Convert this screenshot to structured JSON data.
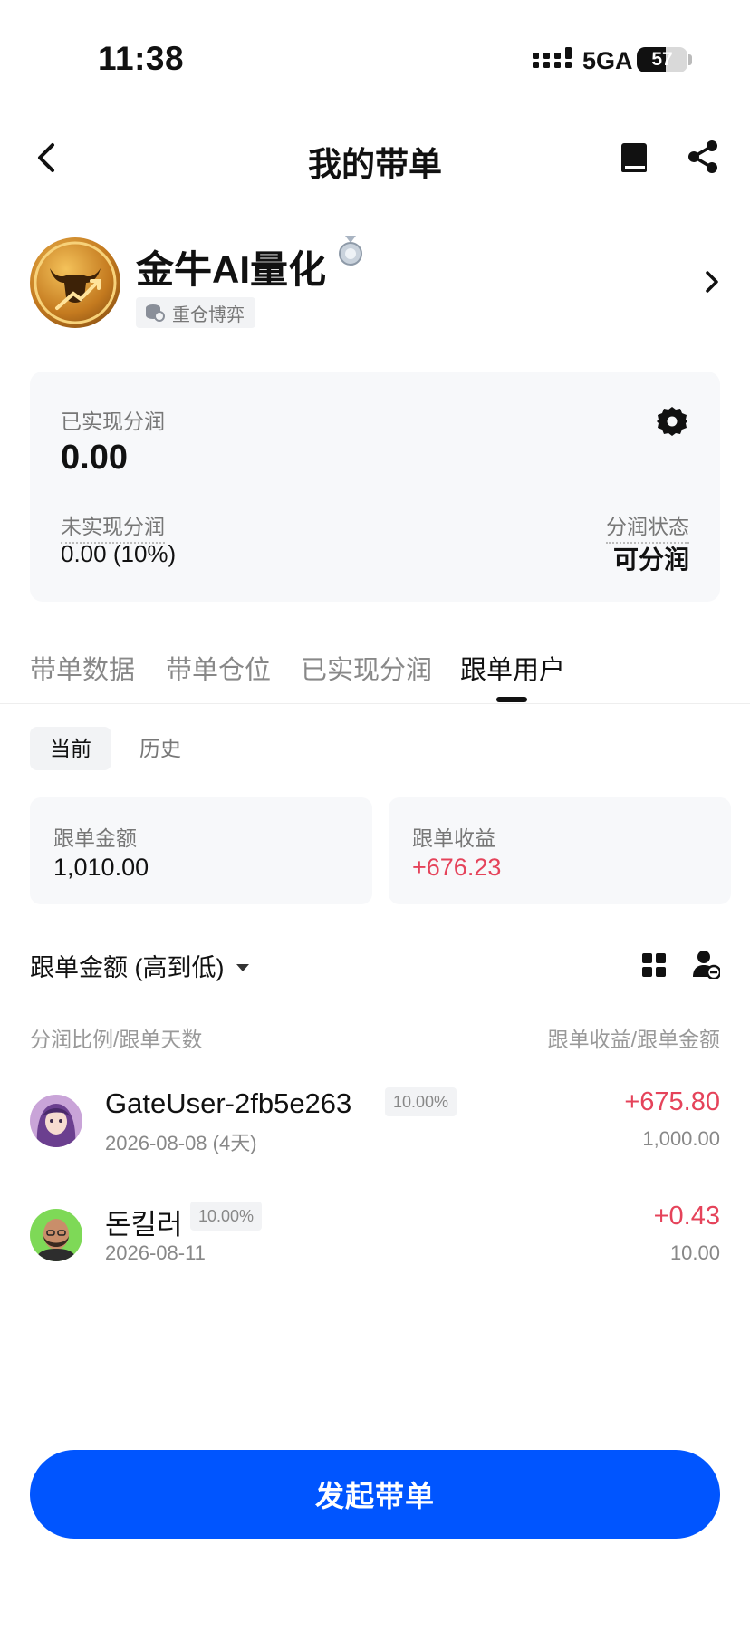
{
  "status_bar": {
    "time": "11:38",
    "network": "5GA",
    "battery": "57",
    "battery_level_percent": 57
  },
  "header": {
    "title": "我的带单",
    "icons": [
      "chevron-left-icon",
      "book-icon",
      "share-icon"
    ]
  },
  "profile": {
    "name": "金牛AI量化",
    "tag": "重仓博弈",
    "medal": "silver"
  },
  "profit_card": {
    "realized_label": "已实现分润",
    "realized_value": "0.00",
    "unrealized_label": "未实现分润",
    "unrealized_value": "0.00 (10%)",
    "status_label": "分润状态",
    "status_value": "可分润"
  },
  "tabs": [
    {
      "label": "带单数据"
    },
    {
      "label": "带单仓位"
    },
    {
      "label": "已实现分润"
    },
    {
      "label": "跟单用户"
    }
  ],
  "active_tab": "跟单用户",
  "sub_tabs": [
    {
      "label": "当前"
    },
    {
      "label": "历史"
    }
  ],
  "stats": [
    {
      "label": "跟单金额",
      "value": "1,010.00"
    },
    {
      "label": "跟单收益",
      "value": "+676.23"
    }
  ],
  "sort": {
    "label": "跟单金额 (高到低)"
  },
  "list_header": {
    "left": "分润比例/跟单天数",
    "right": "跟单收益/跟单金额"
  },
  "followers": [
    {
      "name": "GateUser-2fb5e263",
      "ratio": "10.00%",
      "date": "2026-08-08 (4天)",
      "profit": "+675.80",
      "amount": "1,000.00"
    },
    {
      "name": "돈킬러",
      "ratio": "10.00%",
      "date": "2026-08-11",
      "profit": "+0.43",
      "amount": "10.00"
    }
  ],
  "primary_button": {
    "label": "发起带单"
  },
  "colors": {
    "accent": "#0055ff",
    "positive": "#e5435a",
    "muted": "#888888"
  }
}
